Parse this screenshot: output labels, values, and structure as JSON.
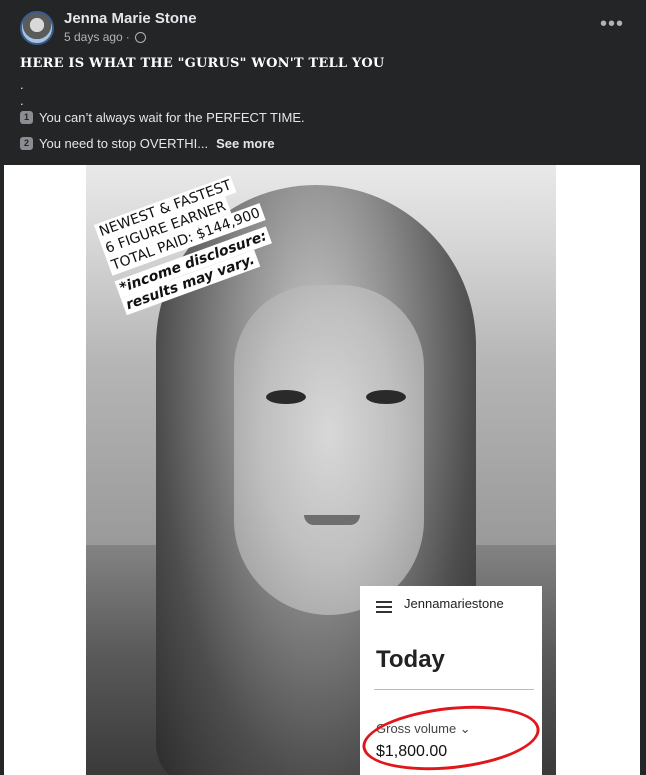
{
  "post": {
    "author": "Jenna Marie Stone",
    "time": "5 days ago",
    "meta_separator": "·",
    "privacy_icon": "globe-icon",
    "more_icon": "more-horizontal-icon",
    "more_glyph": "•••",
    "headline": "HERE IS WHAT THE \"GURUS\" WON'T TELL YOU",
    "dots": [
      ".",
      "."
    ],
    "lines": [
      {
        "num": "1",
        "text": "You can’t always wait for the PERFECT TIME."
      },
      {
        "num": "2",
        "text": "You need to stop OVERTHI..."
      }
    ],
    "see_more": "See more"
  },
  "image": {
    "overlay_lines": [
      "NEWEST & FASTEST",
      "6 FIGURE EARNER",
      "TOTAL PAID: $144,900"
    ],
    "disclosure_lines": [
      "*income disclosure:",
      "results may vary."
    ],
    "card": {
      "account": "Jennamariestone",
      "today": "Today",
      "gross_label": "Gross volume ⌄",
      "amount": "$1,800.00"
    },
    "ring_color": "#e0161b"
  }
}
